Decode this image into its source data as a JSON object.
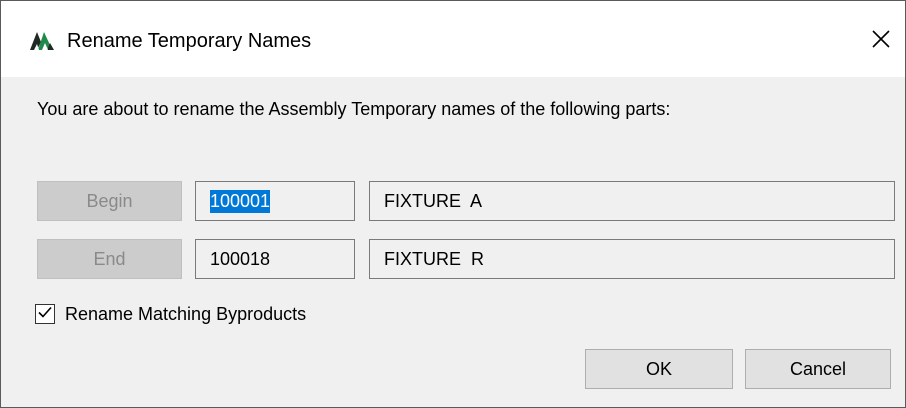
{
  "window": {
    "title": "Rename Temporary Names",
    "icon": "app-logo-icon",
    "close_icon": "close-icon"
  },
  "message": "You are about to rename the Assembly Temporary names of the following parts:",
  "begin": {
    "button_label": "Begin",
    "number": "100001",
    "name": "FIXTURE  A"
  },
  "end": {
    "button_label": "End",
    "number": "100018",
    "name": "FIXTURE  R"
  },
  "checkbox": {
    "label": "Rename Matching Byproducts",
    "checked": true
  },
  "buttons": {
    "ok": "OK",
    "cancel": "Cancel"
  },
  "colors": {
    "selection": "#0078d7",
    "disabled_button": "#cccccc",
    "dialog_background": "#f0f0f0",
    "logo_green": "#1f8a4c",
    "logo_dark": "#1f2a24"
  }
}
